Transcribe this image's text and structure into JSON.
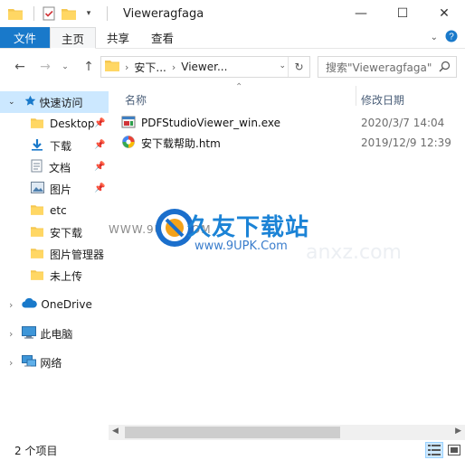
{
  "window": {
    "title": "Vieweragfaga",
    "minimize": "—",
    "maximize": "☐",
    "close": "✕"
  },
  "ribbon": {
    "tabs": [
      {
        "label": "文件"
      },
      {
        "label": "主页"
      },
      {
        "label": "共享"
      },
      {
        "label": "查看"
      }
    ]
  },
  "address": {
    "crumbs": [
      "安下...",
      "Viewer..."
    ],
    "search_placeholder": "搜索\"Vieweragfaga\""
  },
  "nav": {
    "quick_access": "快速访问",
    "items": [
      {
        "label": "Desktop",
        "icon": "folder-icon"
      },
      {
        "label": "下载",
        "icon": "download-icon"
      },
      {
        "label": "文档",
        "icon": "document-icon"
      },
      {
        "label": "图片",
        "icon": "pictures-icon"
      },
      {
        "label": "etc",
        "icon": "folder-icon"
      },
      {
        "label": "安下载",
        "icon": "folder-icon"
      },
      {
        "label": "图片管理器",
        "icon": "folder-icon"
      },
      {
        "label": "未上传",
        "icon": "folder-icon"
      }
    ],
    "onedrive": "OneDrive",
    "this_pc": "此电脑",
    "network": "网络"
  },
  "columns": {
    "name": "名称",
    "date": "修改日期"
  },
  "files": [
    {
      "name": "PDFStudioViewer_win.exe",
      "date": "2020/3/7 14:04",
      "icon": "exe-icon"
    },
    {
      "name": "安下载帮助.htm",
      "date": "2019/12/9 12:39",
      "icon": "htm-icon"
    }
  ],
  "watermark": {
    "left_text": "WWW.9UPK.COM",
    "title": "久友下载站",
    "url": "www.9UPK.Com",
    "ghost": "anxz.com"
  },
  "status": {
    "count": "2 个项目"
  },
  "colors": {
    "accent": "#1979ca",
    "selected": "#cce8ff",
    "folder": "#f5c750"
  }
}
